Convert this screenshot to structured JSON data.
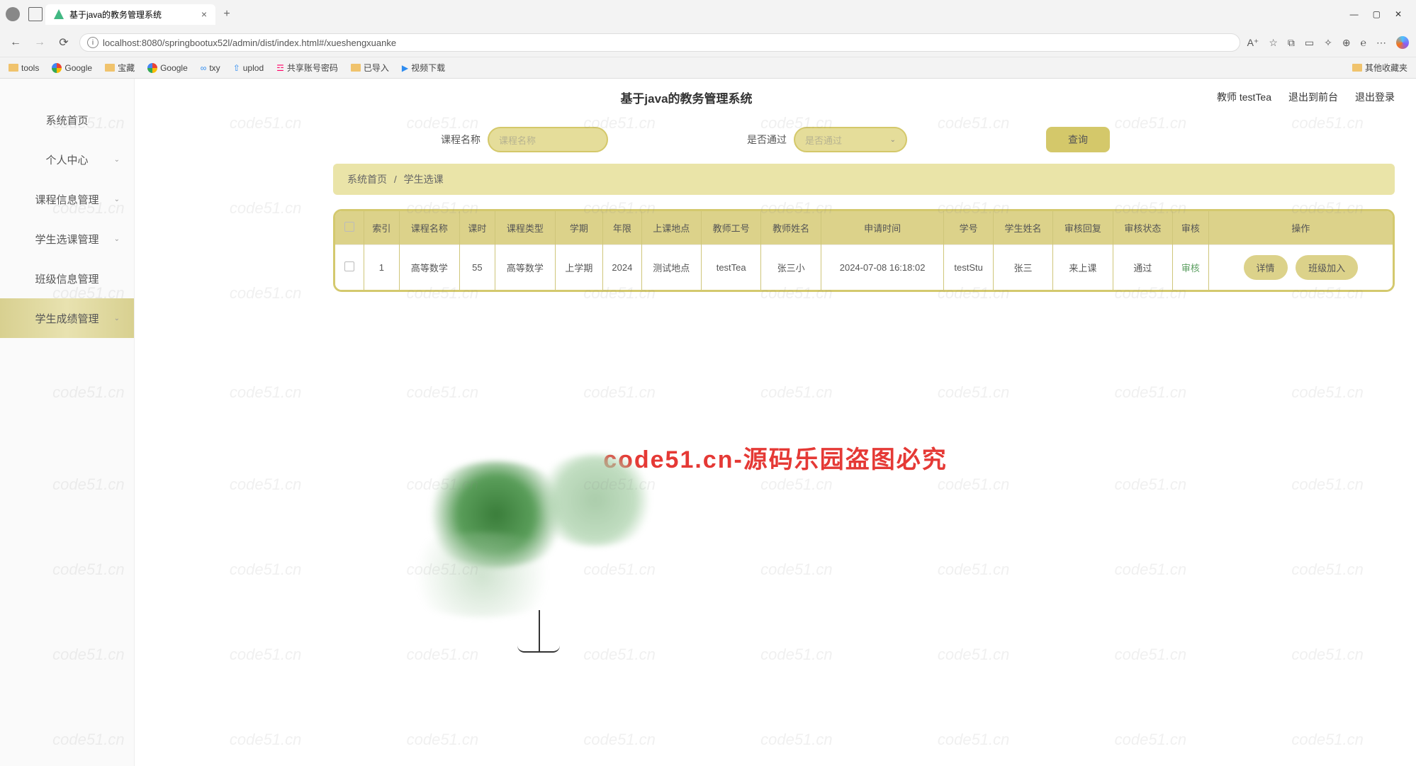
{
  "browser": {
    "tab_title": "基于java的教务管理系统",
    "url": "localhost:8080/springbootux52l/admin/dist/index.html#/xueshengxuanke",
    "bookmarks": [
      "tools",
      "Google",
      "宝藏",
      "Google",
      "txy",
      "uplod",
      "共享账号密码",
      "已导入",
      "视频下载"
    ],
    "other_bookmarks": "其他收藏夹"
  },
  "header": {
    "title": "基于java的教务管理系统",
    "user_role": "教师",
    "user_name": "testTea",
    "link_frontend": "退出到前台",
    "link_logout": "退出登录"
  },
  "sidebar": {
    "items": [
      {
        "label": "系统首页",
        "expandable": false
      },
      {
        "label": "个人中心",
        "expandable": true
      },
      {
        "label": "课程信息管理",
        "expandable": true
      },
      {
        "label": "学生选课管理",
        "expandable": true
      },
      {
        "label": "班级信息管理",
        "expandable": false
      },
      {
        "label": "学生成绩管理",
        "expandable": true
      }
    ]
  },
  "search": {
    "course_label": "课程名称",
    "course_placeholder": "课程名称",
    "pass_label": "是否通过",
    "pass_placeholder": "是否通过",
    "query_btn": "查询"
  },
  "breadcrumb": {
    "home": "系统首页",
    "current": "学生选课"
  },
  "table": {
    "headers": [
      "",
      "索引",
      "课程名称",
      "课时",
      "课程类型",
      "学期",
      "年限",
      "上课地点",
      "教师工号",
      "教师姓名",
      "申请时间",
      "学号",
      "学生姓名",
      "审核回复",
      "审核状态",
      "审核",
      "操作"
    ],
    "rows": [
      {
        "index": "1",
        "course_name": "高等数学",
        "hours": "55",
        "course_type": "高等数学",
        "semester": "上学期",
        "year": "2024",
        "location": "测试地点",
        "teacher_id": "testTea",
        "teacher_name": "张三小",
        "apply_time": "2024-07-08 16:18:02",
        "student_id": "testStu",
        "student_name": "张三",
        "review_reply": "来上课",
        "review_status": "通过",
        "review_action": "审核",
        "op_detail": "详情",
        "op_join": "班级加入"
      }
    ]
  },
  "overlay": {
    "red_text": "code51.cn-源码乐园盗图必究",
    "watermark": "code51.cn"
  }
}
